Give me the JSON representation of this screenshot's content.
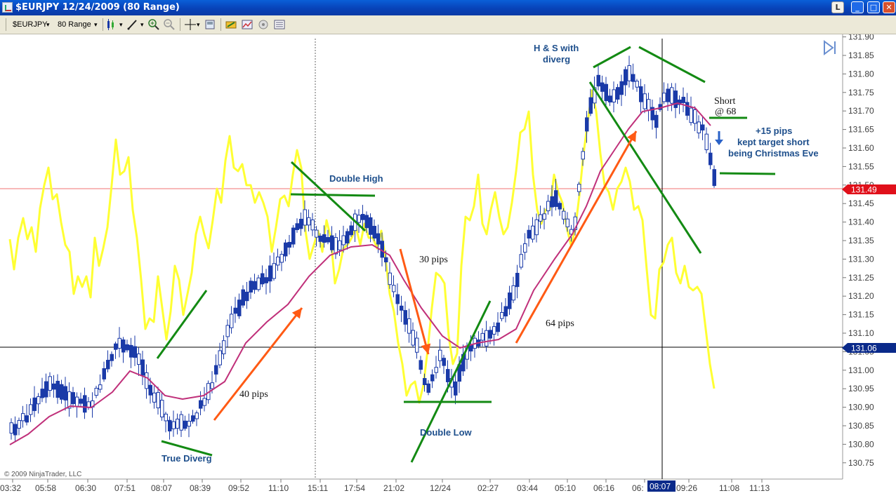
{
  "window": {
    "title": "$EURJPY  12/24/2009 (80 Range)",
    "buttons": [
      "L",
      "_",
      "□",
      "✕"
    ]
  },
  "toolbar": {
    "instrument": "$EURJPY",
    "interval": "80 Range"
  },
  "chart": {
    "copyright": "© 2009 NinjaTrader, LLC",
    "price_axis": [
      "131.90",
      "131.85",
      "131.80",
      "131.75",
      "131.70",
      "131.65",
      "131.60",
      "131.55",
      "131.50",
      "131.45",
      "131.40",
      "131.35",
      "131.30",
      "131.25",
      "131.20",
      "131.15",
      "131.10",
      "131.05",
      "131.00",
      "130.95",
      "130.90",
      "130.85",
      "130.80",
      "130.75"
    ],
    "time_axis": [
      "03:32",
      "05:58",
      "06:30",
      "07:51",
      "08:07",
      "08:39",
      "09:52",
      "11:10",
      "15:11",
      "17:54",
      "21:02",
      "12/24",
      "02:27",
      "03:44",
      "05:10",
      "06:16",
      "06:",
      "09:26",
      "11:08",
      "11:13"
    ],
    "cursor_time": "08:07",
    "current_price": "131.49",
    "crosshair_price": "131.06",
    "colors": {
      "candle": "#1a3aa8",
      "oscillator": "#ffff33",
      "moving_average": "#c0307a",
      "trend_line": "#138a13",
      "arrow": "#ff5a14",
      "label": "#1e4f8c",
      "price_tag": "#e0101a",
      "crosshair_tag": "#0a2a8a"
    }
  },
  "annotations": {
    "hs": [
      "H & S with",
      "diverg"
    ],
    "short": [
      "Short",
      "@ 68"
    ],
    "target": [
      "+15 pips",
      "kept target short",
      "being Christmas Eve"
    ],
    "double_high": "Double High",
    "double_low": "Double Low",
    "true_diverg": "True Diverg",
    "pips30": "30 pips",
    "pips40": "40 pips",
    "pips64": "64 pips"
  }
}
